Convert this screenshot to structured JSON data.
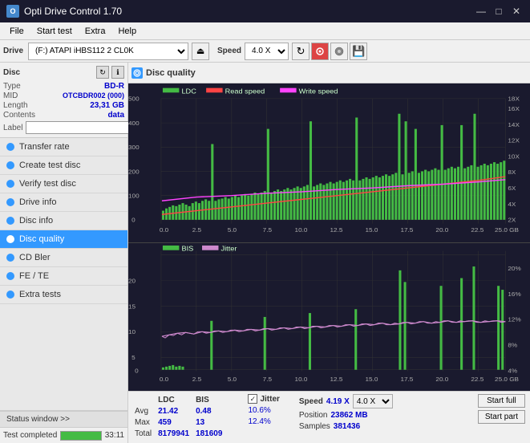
{
  "titleBar": {
    "title": "Opti Drive Control 1.70",
    "icon": "O",
    "controls": [
      "—",
      "□",
      "✕"
    ]
  },
  "menuBar": {
    "items": [
      "File",
      "Start test",
      "Extra",
      "Help"
    ]
  },
  "toolbar": {
    "driveLabel": "Drive",
    "driveValue": "(F:) ATAPI iHBS112  2 CL0K",
    "speedLabel": "Speed",
    "speedValue": "4.0 X"
  },
  "disc": {
    "title": "Disc",
    "type": {
      "label": "Type",
      "value": "BD-R"
    },
    "mid": {
      "label": "MID",
      "value": "OTCBDR002 (000)"
    },
    "length": {
      "label": "Length",
      "value": "23,31 GB"
    },
    "contents": {
      "label": "Contents",
      "value": "data"
    },
    "label": {
      "label": "Label",
      "value": ""
    }
  },
  "navItems": [
    {
      "id": "transfer-rate",
      "label": "Transfer rate",
      "active": false
    },
    {
      "id": "create-test-disc",
      "label": "Create test disc",
      "active": false
    },
    {
      "id": "verify-test-disc",
      "label": "Verify test disc",
      "active": false
    },
    {
      "id": "drive-info",
      "label": "Drive info",
      "active": false
    },
    {
      "id": "disc-info",
      "label": "Disc info",
      "active": false
    },
    {
      "id": "disc-quality",
      "label": "Disc quality",
      "active": true
    },
    {
      "id": "cd-bler",
      "label": "CD Bler",
      "active": false
    },
    {
      "id": "fe-te",
      "label": "FE / TE",
      "active": false
    },
    {
      "id": "extra-tests",
      "label": "Extra tests",
      "active": false
    }
  ],
  "statusWindow": {
    "label": "Status window >>",
    "progressPercent": 100,
    "progressText": "Test completed",
    "timeText": "33:11"
  },
  "contentHeader": {
    "title": "Disc quality"
  },
  "chartTop": {
    "legend": [
      "LDC",
      "Read speed",
      "Write speed"
    ],
    "yAxisLeft": [
      "500",
      "400",
      "300",
      "200",
      "100",
      "0"
    ],
    "yAxisRight": [
      "18X",
      "16X",
      "14X",
      "12X",
      "10X",
      "8X",
      "6X",
      "4X",
      "2X"
    ],
    "xAxis": [
      "0.0",
      "2.5",
      "5.0",
      "7.5",
      "10.0",
      "12.5",
      "15.0",
      "17.5",
      "20.0",
      "22.5",
      "25.0 GB"
    ]
  },
  "chartBottom": {
    "legend": [
      "BIS",
      "Jitter"
    ],
    "yAxisLeft": [
      "20",
      "15",
      "10",
      "5",
      "0"
    ],
    "yAxisRight": [
      "20%",
      "16%",
      "12%",
      "8%",
      "4%"
    ],
    "xAxis": [
      "0.0",
      "2.5",
      "5.0",
      "7.5",
      "10.0",
      "12.5",
      "15.0",
      "17.5",
      "20.0",
      "22.5",
      "25.0 GB"
    ]
  },
  "stats": {
    "columns": {
      "ldc": {
        "header": "LDC",
        "avg": "21.42",
        "max": "459",
        "total": "8179941"
      },
      "bis": {
        "header": "BIS",
        "avg": "0.48",
        "max": "13",
        "total": "181609"
      },
      "jitter": {
        "header": "Jitter",
        "avg": "10.6%",
        "max": "12.4%",
        "total": ""
      },
      "speed": {
        "header": "Speed",
        "value": "4.19 X",
        "select": "4.0 X"
      }
    },
    "rows": [
      "Avg",
      "Max",
      "Total"
    ],
    "position": {
      "label": "Position",
      "value": "23862 MB"
    },
    "samples": {
      "label": "Samples",
      "value": "381436"
    },
    "buttons": {
      "startFull": "Start full",
      "startPart": "Start part"
    }
  }
}
